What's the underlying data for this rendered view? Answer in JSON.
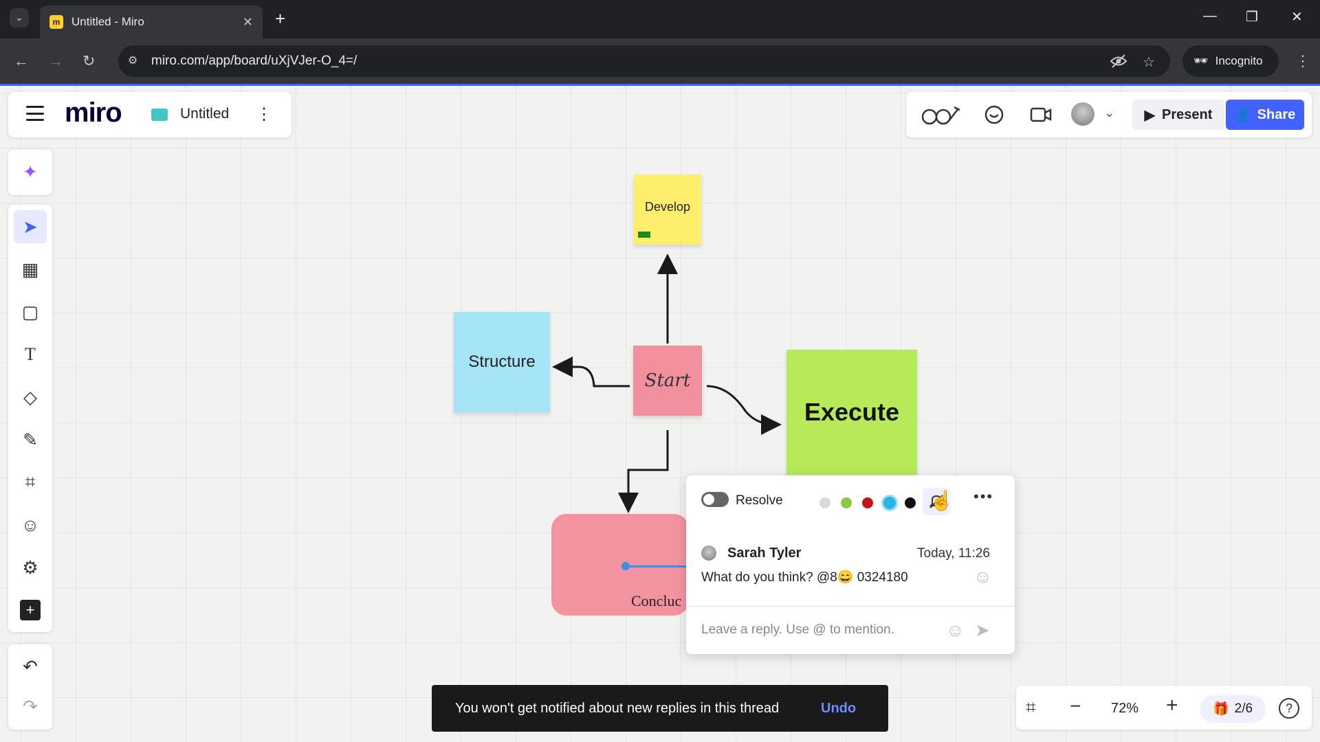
{
  "browser": {
    "tab_title": "Untitled - Miro",
    "url": "miro.com/app/board/uXjVJer-O_4=/",
    "incognito_label": "Incognito"
  },
  "header": {
    "logo": "miro",
    "board_name": "Untitled",
    "present_label": "Present",
    "share_label": "Share"
  },
  "board": {
    "develop": "Develop",
    "structure": "Structure",
    "start": "Start",
    "execute": "Execute",
    "conclusion_partial": "Concluc"
  },
  "comment": {
    "resolve_label": "Resolve",
    "colors": [
      "#d9d9d9",
      "#8dc63f",
      "#c0151c",
      "#2ab4e6",
      "#111111"
    ],
    "author": "Sarah Tyler",
    "time": "Today, 11:26",
    "text": "What do you think? @8😄 0324180",
    "reply_placeholder": "Leave a reply. Use @ to mention."
  },
  "toast": {
    "message": "You won't get notified about new replies in this thread",
    "undo_label": "Undo"
  },
  "footer": {
    "zoom": "72%",
    "page_indicator": "2/6"
  }
}
